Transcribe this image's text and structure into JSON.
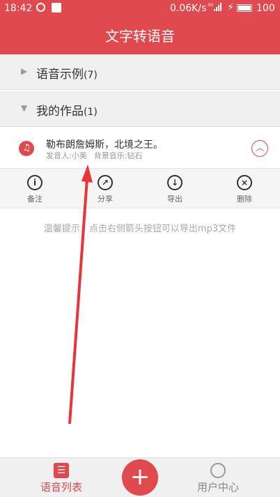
{
  "status_bar": {
    "time": "18:42",
    "network_speed": "0.06K/s",
    "network_type": "4G",
    "battery": "100"
  },
  "app_bar": {
    "title": "文字转语音"
  },
  "sections": [
    {
      "label": "语音示例",
      "count": "(7)",
      "expanded": false
    },
    {
      "label": "我的作品",
      "count": "(1)",
      "expanded": true
    }
  ],
  "work_item": {
    "title": "勒布朗詹姆斯，北境之王。",
    "speaker": "发音人:小美",
    "bgm": "背景音乐:钻石",
    "icon": "music-note-icon"
  },
  "actions": [
    {
      "label": "备注",
      "icon": "info-icon"
    },
    {
      "label": "分享",
      "icon": "share-icon"
    },
    {
      "label": "导出",
      "icon": "download-icon"
    },
    {
      "label": "删除",
      "icon": "close-icon"
    }
  ],
  "tip": "温馨提示：点击右侧箭头按钮可以导出mp3文件",
  "tabs": [
    {
      "label": "语音列表",
      "icon": "list-icon",
      "active": true
    },
    {
      "label": "用户中心",
      "icon": "user-icon",
      "active": false
    }
  ],
  "colors": {
    "primary": "#e04a4e",
    "annotation_arrow": "#e8353a"
  }
}
